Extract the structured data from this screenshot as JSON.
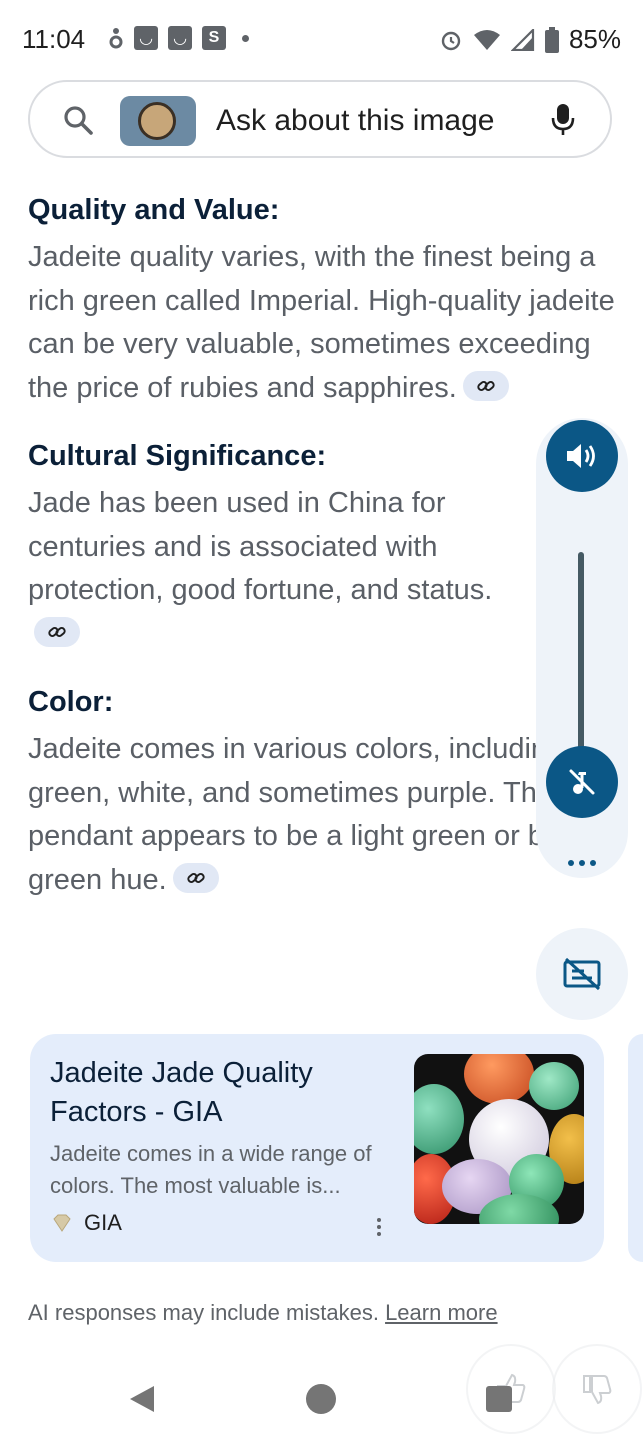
{
  "status_bar": {
    "time": "11:04",
    "left_icons": [
      "accessibility-icon",
      "shopping-bag-icon",
      "shopping-bag-icon",
      "s-app-icon",
      "dot"
    ],
    "s_label": "S",
    "battery": "85%",
    "right_icons": [
      "alarm-icon",
      "wifi-icon",
      "signal-icon",
      "battery-icon"
    ]
  },
  "search": {
    "placeholder": "Ask about this image",
    "icons": [
      "search-icon",
      "mic-icon"
    ]
  },
  "sections": [
    {
      "heading": "Quality and Value:",
      "body": "Jadeite quality varies, with the finest being a rich green called Imperial. High-quality jadeite can be very valuable, sometimes exceeding the price of rubies and sapphires."
    },
    {
      "heading": "Cultural Significance:",
      "body": "Jade has been used in China for centuries and is associated with protection, good fortune, and status."
    },
    {
      "heading": "Color:",
      "body": "Jadeite comes in various colors, including green, white, and sometimes purple. The pendant appears to be a light green or blue-green hue."
    }
  ],
  "media_controls": {
    "icons": [
      "speaker-icon",
      "mute-icon",
      "more-icon",
      "captions-off-icon"
    ]
  },
  "source_card": {
    "title": "Jadeite Jade Quality Factors - GIA",
    "snippet": "Jadeite comes in a wide range of colors. The most valuable is...",
    "source": "GIA"
  },
  "footer": {
    "disclaimer": "AI responses may include mistakes.",
    "learn_more": "Learn more"
  },
  "colors": {
    "heading": "#0b2038",
    "body_text": "#5a5f66",
    "accent": "#0b5786",
    "card_bg": "#e4edfb",
    "chip_bg": "#e1e8f5"
  }
}
